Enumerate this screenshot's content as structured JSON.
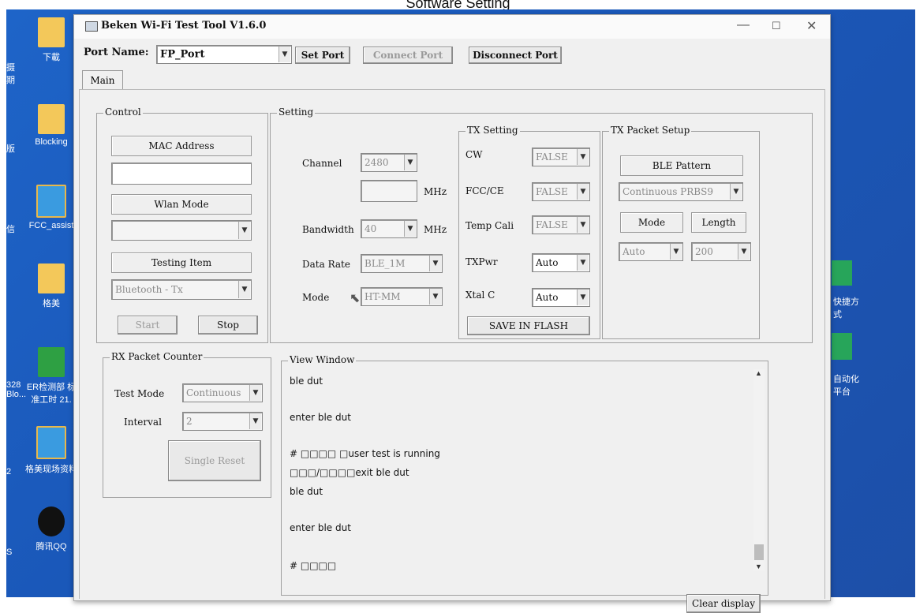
{
  "caption": "Software Setting",
  "desktop": {
    "icons": [
      {
        "label": "下載"
      },
      {
        "label": "Blocking"
      },
      {
        "label": "FCC_assist"
      },
      {
        "label": "格美"
      },
      {
        "label": "ER检测部 标准工时 21."
      },
      {
        "label": "格美现场资料"
      },
      {
        "label": "腾讯QQ"
      }
    ],
    "left_edge": [
      "摄\n期",
      "版",
      "信",
      "328\nBlo...",
      "2",
      "S"
    ],
    "right_edge": [
      "快捷方\n式",
      "自动化\n平台"
    ]
  },
  "window": {
    "title": "Beken Wi-Fi Test Tool V1.6.0",
    "controls": {
      "minimize": "—",
      "maximize": "☐",
      "close": "✕"
    },
    "port_label": "Port Name:",
    "port_value": "FP_Port",
    "set_port": "Set Port",
    "connect_port": "Connect Port",
    "disconnect_port": "Disconnect Port",
    "tab": "Main"
  },
  "control": {
    "title": "Control",
    "mac_header": "MAC Address",
    "mac_value": "",
    "wlan_header": "Wlan Mode",
    "wlan_value": "",
    "testing_header": "Testing Item",
    "testing_value": "Bluetooth - Tx",
    "start": "Start",
    "stop": "Stop"
  },
  "setting": {
    "title": "Setting",
    "channel_label": "Channel",
    "channel_value": "2480",
    "freq_value": "",
    "mhz1": "MHz",
    "bandwidth_label": "Bandwidth",
    "bandwidth_value": "40",
    "mhz2": "MHz",
    "datarate_label": "Data Rate",
    "datarate_value": "BLE_1M",
    "mode_label": "Mode",
    "mode_value": "HT-MM"
  },
  "tx_setting": {
    "title": "TX Setting",
    "cw_label": "CW",
    "cw_value": "FALSE",
    "fcc_label": "FCC/CE",
    "fcc_value": "FALSE",
    "temp_label": "Temp Cali",
    "temp_value": "FALSE",
    "txpwr_label": "TXPwr",
    "txpwr_value": "Auto",
    "xtal_label": "Xtal C",
    "xtal_value": "Auto",
    "save": "SAVE IN FLASH"
  },
  "tx_packet": {
    "title": "TX Packet Setup",
    "pattern_header": "BLE Pattern",
    "pattern_value": "Continuous PRBS9",
    "mode_header": "Mode",
    "length_header": "Length",
    "mode_value": "Auto",
    "length_value": "200"
  },
  "rx_counter": {
    "title": "RX Packet Counter",
    "testmode_label": "Test Mode",
    "testmode_value": "Continuous",
    "interval_label": "Interval",
    "interval_value": "2",
    "single_reset": "Single Reset"
  },
  "view_window": {
    "title": "View Window",
    "lines": [
      "ble dut",
      "enter ble dut",
      "# □□□□  □user test is running",
      "□□□/□□□□exit ble dut",
      "ble dut",
      "enter ble dut",
      "# □□□□"
    ],
    "clear_display": "Clear display"
  }
}
